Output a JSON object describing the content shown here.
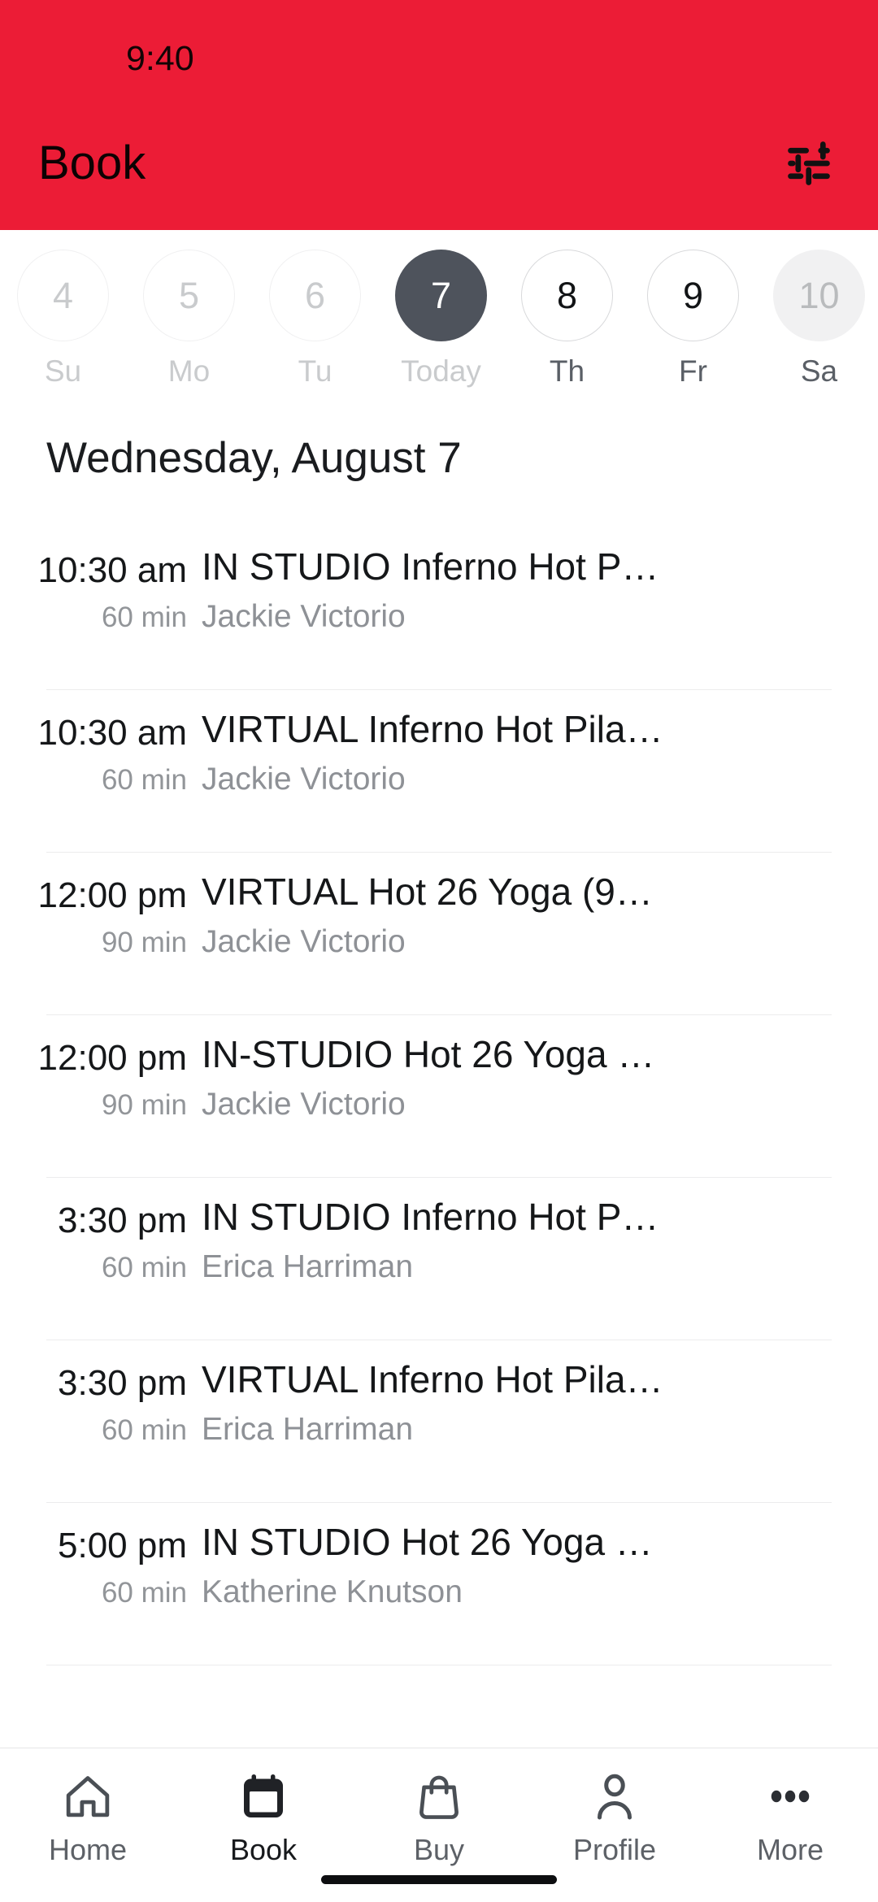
{
  "status_bar": {
    "time": "9:40"
  },
  "header": {
    "title": "Book",
    "filter_icon": "tune-filter-icon",
    "background_color": "#ec1c36",
    "title_color": "#0d0203"
  },
  "date_strip": {
    "days": [
      {
        "number": "4",
        "weekday": "Su",
        "state": "past"
      },
      {
        "number": "5",
        "weekday": "Mo",
        "state": "past"
      },
      {
        "number": "6",
        "weekday": "Tu",
        "state": "past"
      },
      {
        "number": "7",
        "weekday": "Today",
        "state": "selected"
      },
      {
        "number": "8",
        "weekday": "Th",
        "state": "available"
      },
      {
        "number": "9",
        "weekday": "Fr",
        "state": "available"
      },
      {
        "number": "10",
        "weekday": "Sa",
        "state": "filled"
      }
    ],
    "selected_color": "#4e535c",
    "selected_text_color": "#ffffff"
  },
  "date_heading": "Wednesday, August 7",
  "classes": [
    {
      "time": "10:30 am",
      "duration": "60 min",
      "title": "IN STUDIO Inferno Hot P…",
      "instructor": "Jackie Victorio"
    },
    {
      "time": "10:30 am",
      "duration": "60 min",
      "title": "VIRTUAL Inferno Hot Pila…",
      "instructor": "Jackie Victorio"
    },
    {
      "time": "12:00 pm",
      "duration": "90 min",
      "title": "VIRTUAL Hot 26 Yoga (9…",
      "instructor": "Jackie Victorio"
    },
    {
      "time": "12:00 pm",
      "duration": "90 min",
      "title": "IN-STUDIO Hot 26 Yoga …",
      "instructor": "Jackie Victorio"
    },
    {
      "time": "3:30 pm",
      "duration": "60 min",
      "title": "IN STUDIO Inferno Hot P…",
      "instructor": "Erica Harriman"
    },
    {
      "time": "3:30 pm",
      "duration": "60 min",
      "title": "VIRTUAL Inferno Hot Pila…",
      "instructor": "Erica Harriman"
    },
    {
      "time": "5:00 pm",
      "duration": "60 min",
      "title": "IN STUDIO Hot 26 Yoga …",
      "instructor": "Katherine Knutson"
    }
  ],
  "tabbar": {
    "tabs": [
      {
        "label": "Home",
        "icon": "home-icon",
        "active": false
      },
      {
        "label": "Book",
        "icon": "calendar-icon",
        "active": true
      },
      {
        "label": "Buy",
        "icon": "bag-icon",
        "active": false
      },
      {
        "label": "Profile",
        "icon": "person-icon",
        "active": false
      },
      {
        "label": "More",
        "icon": "ellipsis-icon",
        "active": false
      }
    ]
  }
}
